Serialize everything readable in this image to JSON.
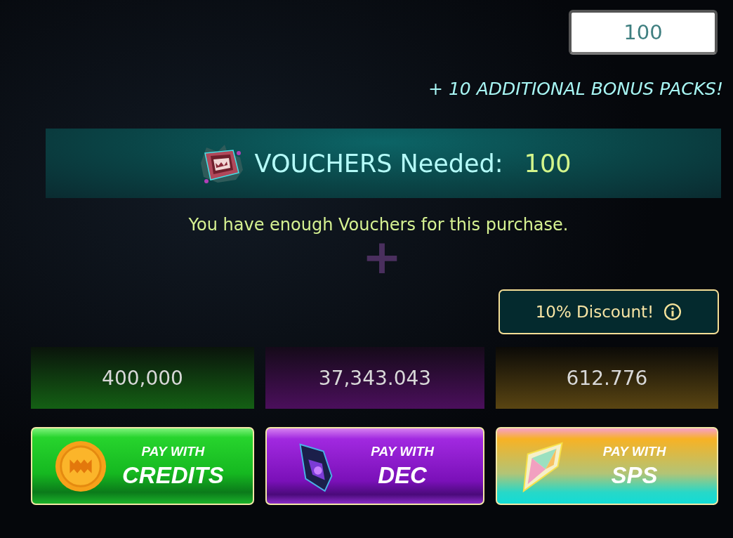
{
  "quantity": {
    "value": "100"
  },
  "bonus": "+ 10 ADDITIONAL BONUS PACKS!",
  "vouchers": {
    "label": "VOUCHERS Needed:",
    "amount": "100"
  },
  "message": "You have enough Vouchers for this purchase.",
  "plus": "+",
  "discount": {
    "label": "10% Discount!"
  },
  "payments": [
    {
      "kind": "credits",
      "price": "400,000",
      "pay_with": "PAY WITH",
      "currency": "CREDITS"
    },
    {
      "kind": "dec",
      "price": "37,343.043",
      "pay_with": "PAY WITH",
      "currency": "DEC"
    },
    {
      "kind": "sps",
      "price": "612.776",
      "pay_with": "PAY WITH",
      "currency": "SPS"
    }
  ]
}
